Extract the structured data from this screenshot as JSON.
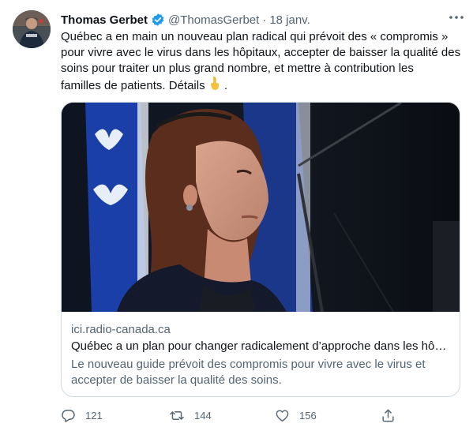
{
  "tweet": {
    "author_name": "Thomas Gerbet",
    "handle": "@ThomasGerbet",
    "separator": "·",
    "date": "18 janv.",
    "text_lines": [
      "Québec a en main un nouveau plan radical qui prévoit des « compromis »",
      "pour vivre avec le virus dans les hôpitaux, accepter de baisser la qualité des",
      "soins pour traiter un plus grand nombre, et mettre à contribution les",
      "familles de patients. Détails"
    ],
    "text_end": " ."
  },
  "card": {
    "domain": "ici.radio-canada.ca",
    "title": "Québec a un plan pour changer radicalement d’approche dans les hôp…",
    "description_lines": [
      "Le nouveau guide prévoit des compromis pour vivre avec le virus et",
      "accepter de baisser la qualité des soins."
    ]
  },
  "actions": {
    "replies": "121",
    "retweets": "144",
    "likes": "156"
  },
  "colors": {
    "text": "#0f1419",
    "secondary": "#536471",
    "verified": "#1d9bf0",
    "border": "#cfd9de"
  },
  "icons": [
    "verified-badge-icon",
    "more-options-icon",
    "pointing-down-emoji",
    "reply-icon",
    "retweet-icon",
    "like-icon",
    "share-icon"
  ]
}
